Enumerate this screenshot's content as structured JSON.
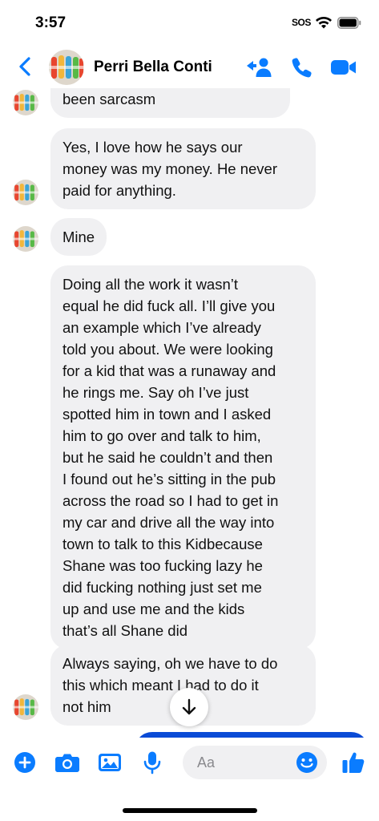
{
  "status_bar": {
    "time": "3:57",
    "sos": "SOS"
  },
  "header": {
    "contact_name": "Perri Bella Conti",
    "back_icon": "chevron-left-icon",
    "icons": [
      "add-person-icon",
      "phone-icon",
      "video-camera-icon"
    ],
    "accent_color": "#0a7cff"
  },
  "messages": [
    {
      "sender": "Perri Bella Conti",
      "text": "been sarcasm",
      "avatar_shown": true
    },
    {
      "sender": "Perri Bella Conti",
      "text": "Yes, I love how he says our\nmoney was my money. He never\npaid for anything.",
      "avatar_shown": true
    },
    {
      "sender": "Perri Bella Conti",
      "text": "Mine",
      "avatar_shown": true
    },
    {
      "sender": "Perri Bella Conti",
      "text": "Doing all the work it wasn’t\nequal he did fuck all. I’ll give you\nan example which I’ve already\ntold you about. We were looking\nfor a kid that was a runaway and\nhe rings me. Say oh I’ve just\nspotted him in town and I asked\nhim to go over and talk to him,\nbut he said he couldn’t and then\nI found out he’s sitting in the pub\nacross the road so I had to get in\nmy car and drive all the way into\ntown to talk to this Kidbecause\nShane was too fucking lazy he\ndid fucking nothing just set me\nup and use me and the kids\nthat’s all Shane did",
      "avatar_shown": false
    },
    {
      "sender": "Perri Bella Conti",
      "text": "Always saying, oh we have to do\nthis which meant I had to do it\nnot him",
      "avatar_shown": true
    }
  ],
  "scroll_down_icon": "arrow-down-icon",
  "composer": {
    "placeholder": "Aa",
    "icons": [
      "plus-circle-icon",
      "camera-icon",
      "photo-icon",
      "microphone-icon",
      "emoji-icon",
      "thumbs-up-icon"
    ],
    "accent_color": "#0a7cff",
    "sent_bubble_color": "#0a4bd6"
  }
}
